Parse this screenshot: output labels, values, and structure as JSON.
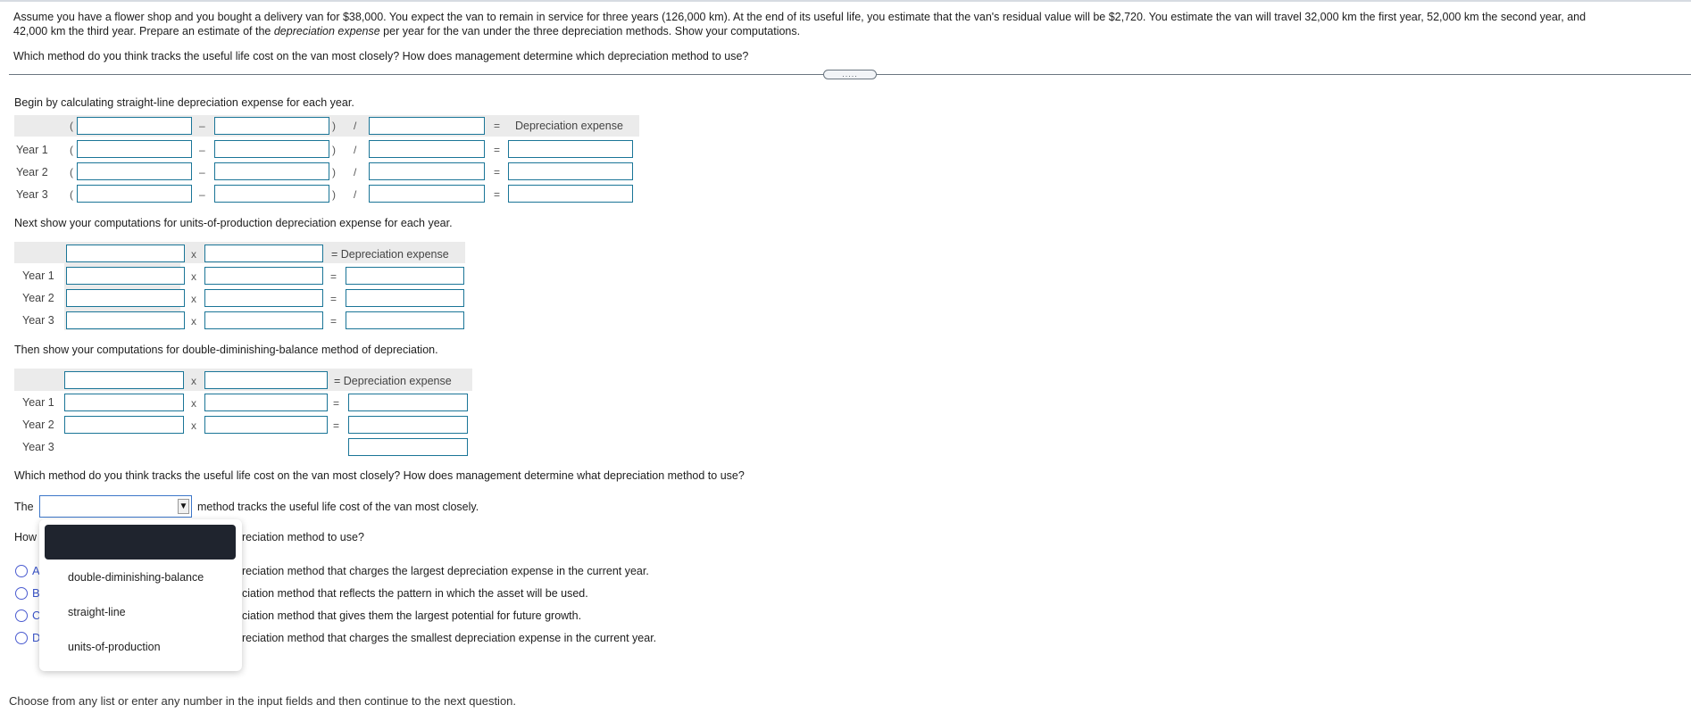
{
  "intro": {
    "line1": "Assume you have a flower shop and you bought a delivery van for $38,000. You expect the van to remain in service for three years (126,000 km). At the end of its useful life, you estimate that the van's residual value will be $2,720. You estimate the van will travel 32,000 km the first year, 52,000 km the second year, and",
    "line2_pre": "42,000 km the third year. Prepare an estimate of the ",
    "line2_em": "depreciation expense",
    "line2_post": " per year for the van under the three depreciation methods. Show your computations.",
    "question": "Which method do you think tracks the useful life cost on the van most closely? How does management determine which depreciation method to use?"
  },
  "divider_handle": ".....",
  "straight_line": {
    "title": "Begin by calculating straight-line depreciation expense for each year.",
    "open_paren": "(",
    "minus": "–",
    "close_paren": ")",
    "divide": "/",
    "equals": "=",
    "result_header": "Depreciation expense",
    "rows": [
      "Year 1",
      "Year 2",
      "Year 3"
    ]
  },
  "units_of_production": {
    "title": "Next show your computations for units-of-production depreciation expense for each year.",
    "times": "x",
    "equals": "=",
    "result_header": "= Depreciation expense",
    "rows": [
      "Year 1",
      "Year 2",
      "Year 3"
    ]
  },
  "double_diminishing": {
    "title": "Then show your computations for double-diminishing-balance method of depreciation.",
    "times": "x",
    "equals": "=",
    "result_header": "= Depreciation expense",
    "rows": [
      "Year 1",
      "Year 2",
      "Year 3"
    ]
  },
  "question2": {
    "text": "Which method do you think tracks the useful life cost on the van most closely? How does management determine what depreciation method to use?",
    "sentence_pre": "The",
    "sentence_post": "method tracks the useful life cost of the van most closely.",
    "select_value": "",
    "how_pre": "How",
    "how_post": "reciation method to use?",
    "dropdown_options": [
      "",
      "double-diminishing-balance",
      "straight-line",
      "units-of-production"
    ],
    "radio_options": [
      {
        "letter": "A",
        "text": "reciation method that charges the largest depreciation expense in the current year."
      },
      {
        "letter": "B",
        "text": "ciation method that reflects the pattern in which the asset will be used."
      },
      {
        "letter": "C",
        "text": "ciation method that gives them the largest potential for future growth."
      },
      {
        "letter": "D",
        "text": "reciation method that charges the smallest depreciation expense in the current year."
      }
    ]
  },
  "footer": "Choose from any list or enter any number in the input fields and then continue to the next question."
}
